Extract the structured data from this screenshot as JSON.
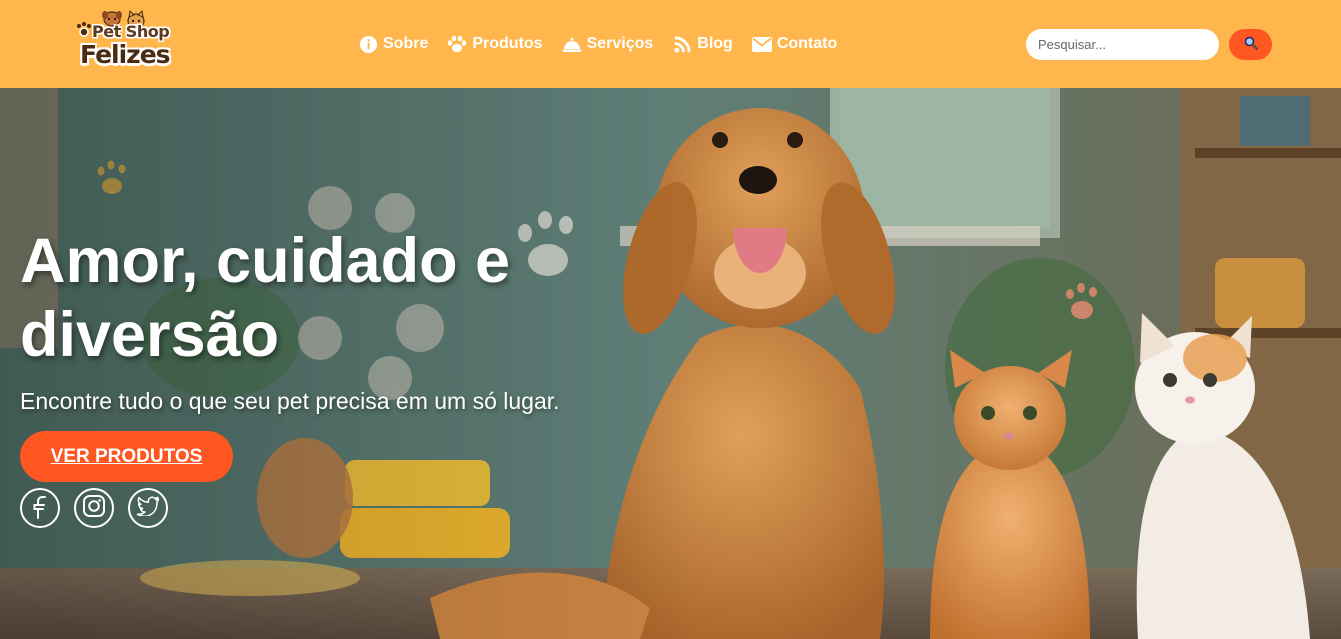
{
  "brand": {
    "line1": "Pet Shop",
    "line2": "Felizes",
    "colors": {
      "header_bg": "#ffb74d",
      "accent": "#ff5722",
      "brown": "#4a2c14"
    }
  },
  "nav": {
    "items": [
      {
        "label": "Sobre",
        "icon": "info-circle-icon"
      },
      {
        "label": "Produtos",
        "icon": "paw-icon"
      },
      {
        "label": "Serviços",
        "icon": "service-bell-icon"
      },
      {
        "label": "Blog",
        "icon": "rss-icon"
      },
      {
        "label": "Contato",
        "icon": "envelope-icon"
      }
    ]
  },
  "search": {
    "placeholder": "Pesquisar...",
    "value": "",
    "button_icon": "magnifier-icon"
  },
  "hero": {
    "title": "Amor, cuidado e diversão",
    "subtitle": "Encontre tudo o que seu pet precisa em um só lugar.",
    "cta_label": "VER PRODUTOS",
    "social": [
      {
        "icon": "facebook-icon"
      },
      {
        "icon": "instagram-icon"
      },
      {
        "icon": "twitter-icon"
      }
    ]
  }
}
